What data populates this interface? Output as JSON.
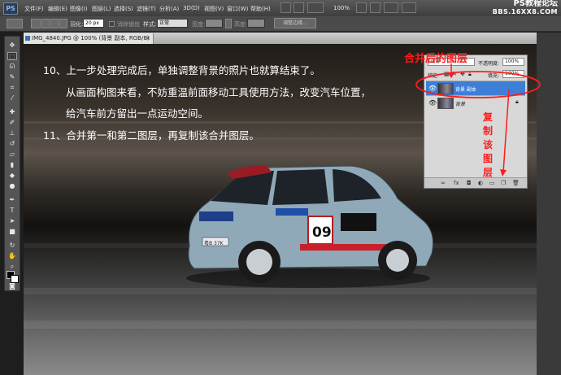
{
  "app": {
    "logo": "PS"
  },
  "menubar": {
    "items": [
      "文件(F)",
      "编辑(E)",
      "图像(I)",
      "图层(L)",
      "选择(S)",
      "滤镜(T)",
      "分析(A)",
      "3D(D)",
      "视图(V)",
      "窗口(W)",
      "帮助(H)"
    ],
    "zoom_value": "100%"
  },
  "watermark": {
    "line1": "PS教程论坛",
    "line2": "BBS.16XX8.COM"
  },
  "options_bar": {
    "feather_label": "羽化:",
    "feather_value": "20 px",
    "antialias_label": "消除锯齿",
    "style_label": "样式:",
    "style_value": "正常",
    "width_label": "宽度:",
    "height_label": "高度:",
    "refine_edge_button": "调整边缘..."
  },
  "document": {
    "tab_title": "IMG_4840.JPG @ 100% (背景 副本, RGB/8) *"
  },
  "canvas_text": {
    "line1": "10、上一步处理完成后，单独调整背景的照片也就算结束了。",
    "line2": "从画面构图来看，不妨重温前面移动工具使用方法，改变汽车位置，",
    "line3": "给汽车前方留出一点运动空间。",
    "line4": "11、合并第一和第二图层，再复制该合并图层。"
  },
  "layers_panel": {
    "blend_mode": "正常",
    "opacity_label": "不透明度:",
    "opacity_value": "100%",
    "lock_label": "锁定:",
    "fill_label": "填充:",
    "fill_value": "100%",
    "layers": [
      {
        "name": "背景 副本",
        "selected": true
      },
      {
        "name": "背景",
        "selected": false
      }
    ]
  },
  "annotations": {
    "merged_layer": "合并后的图层",
    "copy_layer": [
      "复",
      "制",
      "该",
      "图",
      "层"
    ]
  },
  "car": {
    "number": "09",
    "plate": "粤B 37K",
    "body_color": "#8fa9b8"
  },
  "colors": {
    "annotation_red": "#ff1b1b",
    "layer_selected": "#3d7fd6"
  }
}
